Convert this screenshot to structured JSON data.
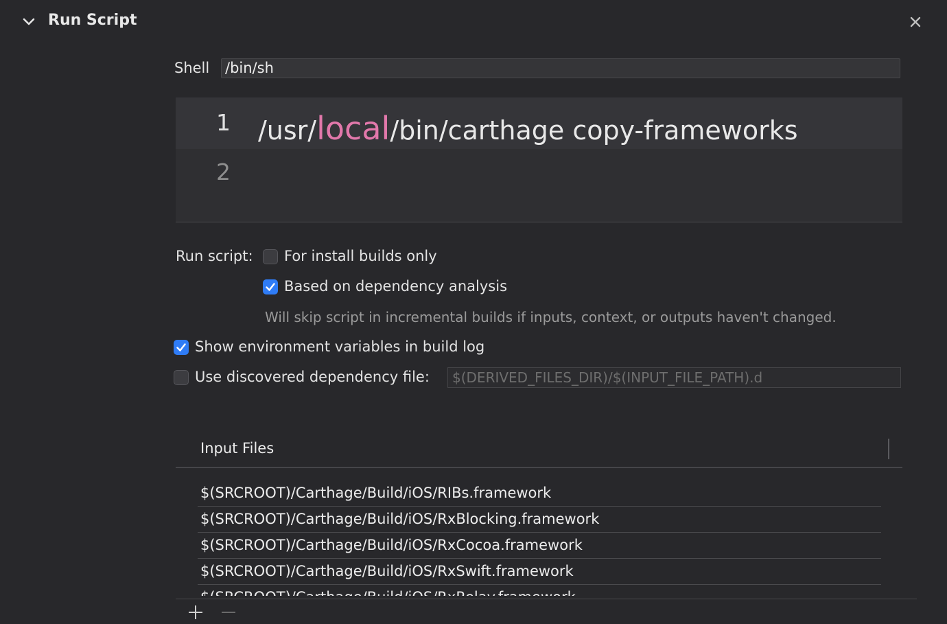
{
  "header": {
    "title": "Run Script",
    "icons": [
      "chevron-down-icon",
      "close-icon"
    ]
  },
  "shell": {
    "label": "Shell",
    "value": "/bin/sh"
  },
  "editor": {
    "lines": [
      {
        "number": "1",
        "segments": [
          "/usr/",
          "local",
          "/bin/carthage copy-frameworks"
        ]
      },
      {
        "number": "2",
        "segments": []
      }
    ],
    "keyword_color": "#e278ab"
  },
  "options": {
    "run_script_label": "Run script:",
    "install_builds_only": {
      "label": "For install builds only",
      "checked": false
    },
    "dependency_analysis": {
      "label": "Based on dependency analysis",
      "checked": true
    },
    "dependency_hint": "Will skip script in incremental builds if inputs, context, or outputs haven't changed.",
    "show_env_vars": {
      "label": "Show environment variables in build log",
      "checked": true
    },
    "use_dep_file": {
      "label": "Use discovered dependency file:",
      "checked": false,
      "placeholder": "$(DERIVED_FILES_DIR)/$(INPUT_FILE_PATH).d"
    }
  },
  "input_files": {
    "header": "Input Files",
    "rows": [
      "$(SRCROOT)/Carthage/Build/iOS/RIBs.framework",
      "$(SRCROOT)/Carthage/Build/iOS/RxBlocking.framework",
      "$(SRCROOT)/Carthage/Build/iOS/RxCocoa.framework",
      "$(SRCROOT)/Carthage/Build/iOS/RxSwift.framework",
      "$(SRCROOT)/Carthage/Build/iOS/RxRelay.framework"
    ]
  },
  "colors": {
    "background": "#28282b",
    "accent": "#2f7cf6"
  }
}
